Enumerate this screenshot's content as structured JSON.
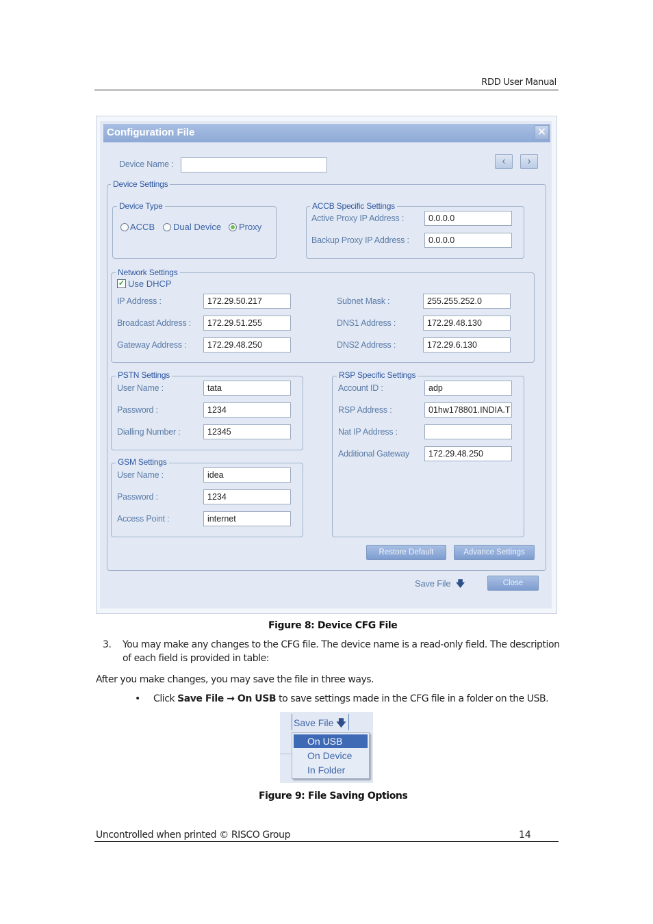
{
  "page": {
    "header_title": "RDD User Manual",
    "footer_left": "Uncontrolled when printed © RISCO Group",
    "page_number": "14"
  },
  "dialog": {
    "title": "Configuration File",
    "close_icon": "close-icon",
    "device_name_label": "Device Name :",
    "device_name_value": "",
    "prev_icon": "chevron-left-icon",
    "next_icon": "chevron-right-icon",
    "device_settings_legend": "Device Settings",
    "device_type": {
      "legend": "Device Type",
      "options": [
        "ACCB",
        "Dual Device",
        "Proxy"
      ],
      "selected": "Proxy"
    },
    "accb": {
      "legend": "ACCB Specific Settings",
      "active_proxy_label": "Active Proxy IP Address :",
      "active_proxy_value": "0.0.0.0",
      "backup_proxy_label": "Backup Proxy IP Address :",
      "backup_proxy_value": "0.0.0.0"
    },
    "network": {
      "legend": "Network Settings",
      "use_dhcp_label": "Use DHCP",
      "use_dhcp_checked": true,
      "ip_label": "IP Address :",
      "ip_value": "172.29.50.217",
      "broadcast_label": "Broadcast Address :",
      "broadcast_value": "172.29.51.255",
      "gateway_label": "Gateway Address :",
      "gateway_value": "172.29.48.250",
      "subnet_label": "Subnet Mask :",
      "subnet_value": "255.255.252.0",
      "dns1_label": "DNS1 Address :",
      "dns1_value": "172.29.48.130",
      "dns2_label": "DNS2 Address :",
      "dns2_value": "172.29.6.130"
    },
    "pstn": {
      "legend": "PSTN Settings",
      "user_label": "User Name :",
      "user_value": "tata",
      "password_label": "Password :",
      "password_value": "1234",
      "dialling_label": "Dialling Number :",
      "dialling_value": "12345"
    },
    "gsm": {
      "legend": "GSM Settings",
      "user_label": "User Name :",
      "user_value": "idea",
      "password_label": "Password :",
      "password_value": "1234",
      "apn_label": "Access Point :",
      "apn_value": "internet"
    },
    "rsp": {
      "legend": "RSP Specific Settings",
      "account_label": "Account ID :",
      "account_value": "adp",
      "address_label": "RSP Address :",
      "address_value": "01hw178801.INDIA.T",
      "nat_label": "Nat IP Address :",
      "nat_value": "",
      "gateway_label": "Additional Gateway",
      "gateway_value": "172.29.48.250"
    },
    "restore_default": "Restore Default",
    "advance_settings": "Advance Settings",
    "save_file": "Save File",
    "save_icon": "arrow-down-icon",
    "close": "Close"
  },
  "text": {
    "figure8_caption": "Figure 8: Device CFG File",
    "step_number": "3.",
    "step_line1": "You may make any changes to the CFG file. The device name is a read-only field. The description",
    "step_line2": "of each field is provided in table:",
    "para": "After you make changes, you may save the file in three ways.",
    "bullet_prefix": "Click ",
    "bullet_bold1": "Save File",
    "bullet_arrow": " → ",
    "bullet_bold2": "On USB",
    "bullet_suffix": " to save settings made in the CFG file in a folder on the USB.",
    "figure9_caption": "Figure 9: File Saving Options"
  },
  "figure9": {
    "save_file": "Save File",
    "menu": [
      "On USB",
      "On Device",
      "In Folder"
    ],
    "selected": "On USB"
  }
}
